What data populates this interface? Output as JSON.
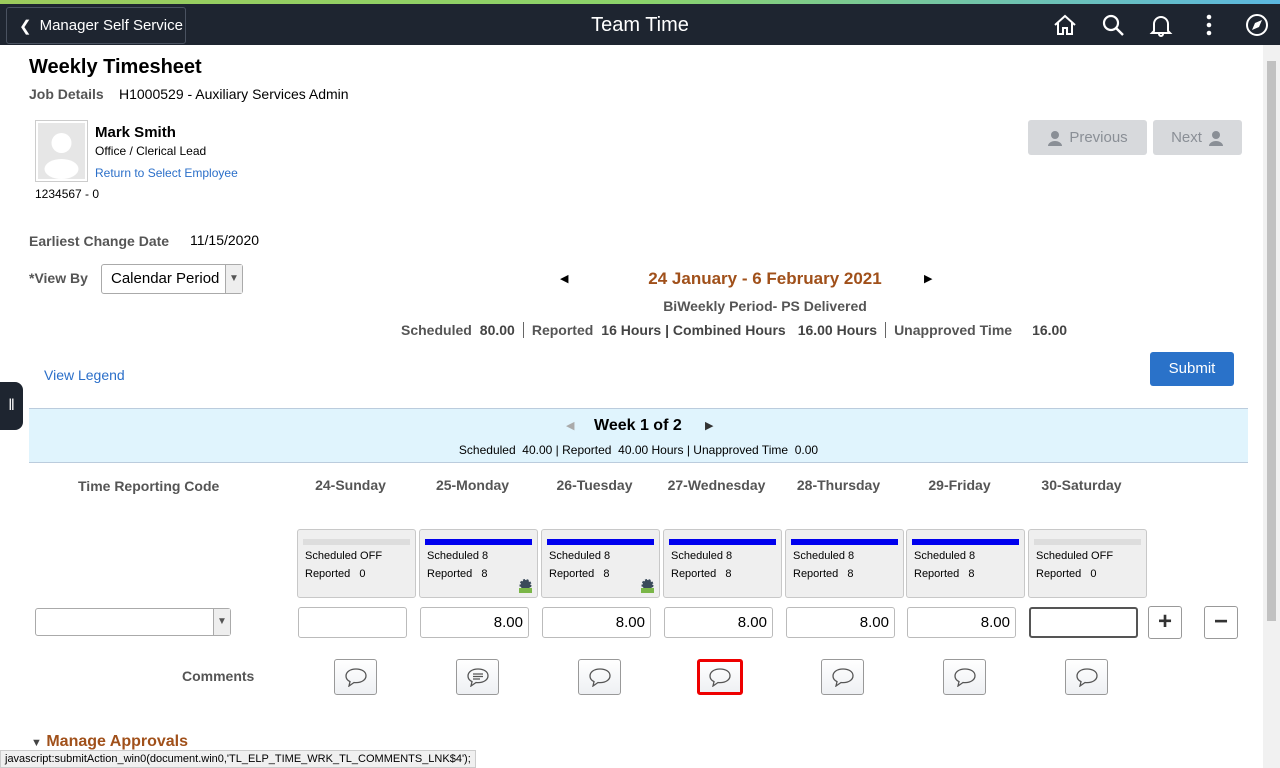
{
  "header": {
    "back_label": "Manager Self Service",
    "title": "Team Time",
    "icons": [
      "home-icon",
      "search-icon",
      "bell-icon",
      "more-vertical-icon",
      "compass-icon"
    ]
  },
  "page": {
    "title": "Weekly Timesheet",
    "job_details_label": "Job Details",
    "job_details_value": "H1000529 - Auxiliary Services Admin"
  },
  "employee": {
    "name": "Mark Smith",
    "title": "Office / Clerical Lead",
    "return_link": "Return to Select Employee",
    "id": "1234567 - 0"
  },
  "nav": {
    "previous": "Previous",
    "next": "Next"
  },
  "earliest_change": {
    "label": "Earliest Change Date",
    "value": "11/15/2020"
  },
  "view_by": {
    "label": "*View By",
    "value": "Calendar Period"
  },
  "period": {
    "title": "24 January - 6 February 2021",
    "subtitle": "BiWeekly Period- PS Delivered",
    "scheduled_label": "Scheduled",
    "scheduled_value": "80.00",
    "reported_label": "Reported",
    "reported_value": "16 Hours | Combined Hours",
    "combined_value": "16.00 Hours",
    "unapproved_label": "Unapproved Time",
    "unapproved_value": "16.00"
  },
  "view_legend": "View Legend",
  "submit": "Submit",
  "week": {
    "title": "Week 1 of 2",
    "summary": "Scheduled  40.00 | Reported  40.00 Hours | Unapproved Time  0.00"
  },
  "trc_label": "Time Reporting Code",
  "comments_label": "Comments",
  "days": [
    {
      "header": "24-Sunday",
      "scheduled": "Scheduled OFF",
      "reported": "Reported   0",
      "hours": "",
      "bar": "#dddddd",
      "gear": false,
      "comment_icon": "comment-icon"
    },
    {
      "header": "25-Monday",
      "scheduled": "Scheduled 8",
      "reported": "Reported   8",
      "hours": "8.00",
      "bar": "#0000ee",
      "gear": true,
      "comment_icon": "comment-text-icon"
    },
    {
      "header": "26-Tuesday",
      "scheduled": "Scheduled 8",
      "reported": "Reported   8",
      "hours": "8.00",
      "bar": "#0000ee",
      "gear": true,
      "comment_icon": "comment-icon"
    },
    {
      "header": "27-Wednesday",
      "scheduled": "Scheduled 8",
      "reported": "Reported   8",
      "hours": "8.00",
      "bar": "#0000ee",
      "gear": false,
      "comment_icon": "comment-icon"
    },
    {
      "header": "28-Thursday",
      "scheduled": "Scheduled 8",
      "reported": "Reported   8",
      "hours": "8.00",
      "bar": "#0000ee",
      "gear": false,
      "comment_icon": "comment-icon"
    },
    {
      "header": "29-Friday",
      "scheduled": "Scheduled 8",
      "reported": "Reported   8",
      "hours": "8.00",
      "bar": "#0000ee",
      "gear": false,
      "comment_icon": "comment-icon"
    },
    {
      "header": "30-Saturday",
      "scheduled": "Scheduled OFF",
      "reported": "Reported   0",
      "hours": "",
      "bar": "#dddddd",
      "gear": false,
      "comment_icon": "comment-icon"
    }
  ],
  "manage_approvals": "Manage Approvals",
  "status_bar": "javascript:submitAction_win0(document.win0,'TL_ELP_TIME_WRK_TL_COMMENTS_LNK$4');",
  "colors": {
    "header_bg": "#1e2530",
    "accent_orange": "#a0501a",
    "link": "#2b6fc9",
    "submit": "#2a72c9",
    "week_band": "#e0f4fd"
  }
}
